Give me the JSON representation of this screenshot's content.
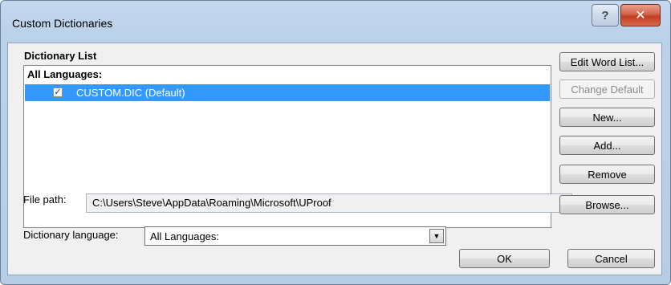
{
  "window": {
    "title": "Custom Dictionaries",
    "help_label": "?",
    "close_label": "✕"
  },
  "dictionary_list": {
    "group_label": "Dictionary List",
    "header": "All Languages:",
    "items": [
      {
        "label": "CUSTOM.DIC (Default)",
        "checked": true,
        "selected": true
      }
    ]
  },
  "buttons": {
    "edit_word_list": "Edit Word List...",
    "change_default": "Change Default",
    "new": "New...",
    "add": "Add...",
    "remove": "Remove",
    "browse": "Browse...",
    "ok": "OK",
    "cancel": "Cancel"
  },
  "file_path": {
    "label": "File path:",
    "value": "C:\\Users\\Steve\\AppData\\Roaming\\Microsoft\\UProof"
  },
  "dictionary_language": {
    "label": "Dictionary language:",
    "value": "All Languages:"
  },
  "colors": {
    "selection": "#3399ff",
    "title_bar": "#bcd2ea",
    "close_button": "#c23f21"
  }
}
